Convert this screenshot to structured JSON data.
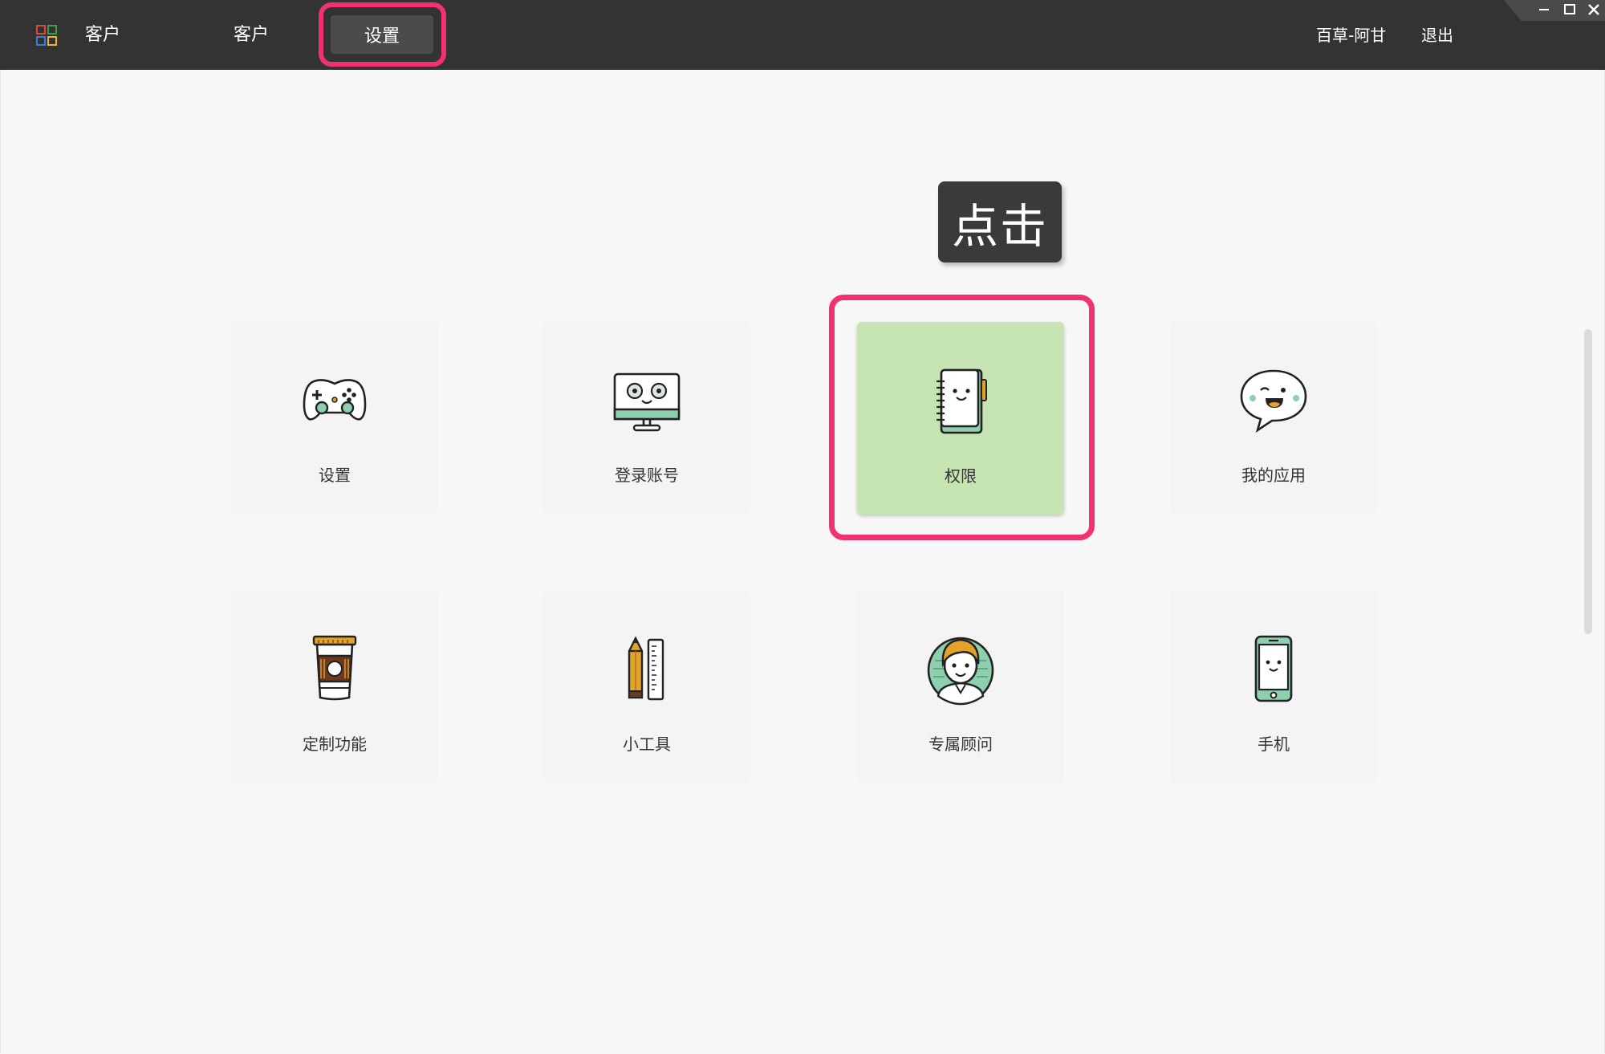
{
  "header": {
    "app_title": "客户",
    "nav": {
      "customers": "客户",
      "settings": "设置"
    },
    "user_name": "百草-阿甘",
    "logout": "退出"
  },
  "tooltip": {
    "text": "点击"
  },
  "tiles": [
    {
      "label": "设置",
      "icon": "gamepad-icon"
    },
    {
      "label": "登录账号",
      "icon": "monitor-icon"
    },
    {
      "label": "权限",
      "icon": "notebook-icon",
      "active": true
    },
    {
      "label": "我的应用",
      "icon": "chat-bubble-icon"
    },
    {
      "label": "定制功能",
      "icon": "coffee-cup-icon"
    },
    {
      "label": "小工具",
      "icon": "pencil-ruler-icon"
    },
    {
      "label": "专属顾问",
      "icon": "advisor-avatar-icon"
    },
    {
      "label": "手机",
      "icon": "phone-icon"
    }
  ],
  "colors": {
    "topbar": "#333333",
    "highlight": "#f2326e",
    "active_tile": "#c7e5b3",
    "accent_green": "#8ecfae"
  }
}
